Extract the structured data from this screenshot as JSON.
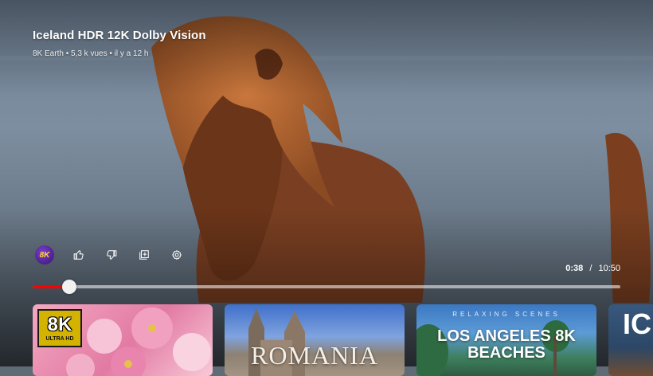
{
  "video": {
    "title": "Iceland HDR 12K Dolby Vision",
    "channel": "8K Earth",
    "views": "5,3 k vues",
    "age": "il y a 12 h",
    "separator": "•"
  },
  "channel_avatar": {
    "label": "8K"
  },
  "controls": [
    {
      "name": "like-button",
      "icon": "thumbs-up-icon"
    },
    {
      "name": "dislike-button",
      "icon": "thumbs-down-icon"
    },
    {
      "name": "save-to-playlist-button",
      "icon": "playlist-add-icon"
    },
    {
      "name": "settings-button",
      "icon": "gear-icon"
    }
  ],
  "player": {
    "current_time": "0:38",
    "time_separator": "/",
    "duration": "10:50",
    "progress_fraction": 0.063,
    "progress_color": "#ff0000"
  },
  "recommendations": [
    {
      "badge": "8K",
      "badge_sub": "ULTRA HD"
    },
    {
      "title": "ROMANIA"
    },
    {
      "subtitle": "RELAXING SCENES",
      "title": "LOS ANGELES 8K",
      "title2": "BEACHES"
    },
    {
      "title": "IC"
    }
  ]
}
